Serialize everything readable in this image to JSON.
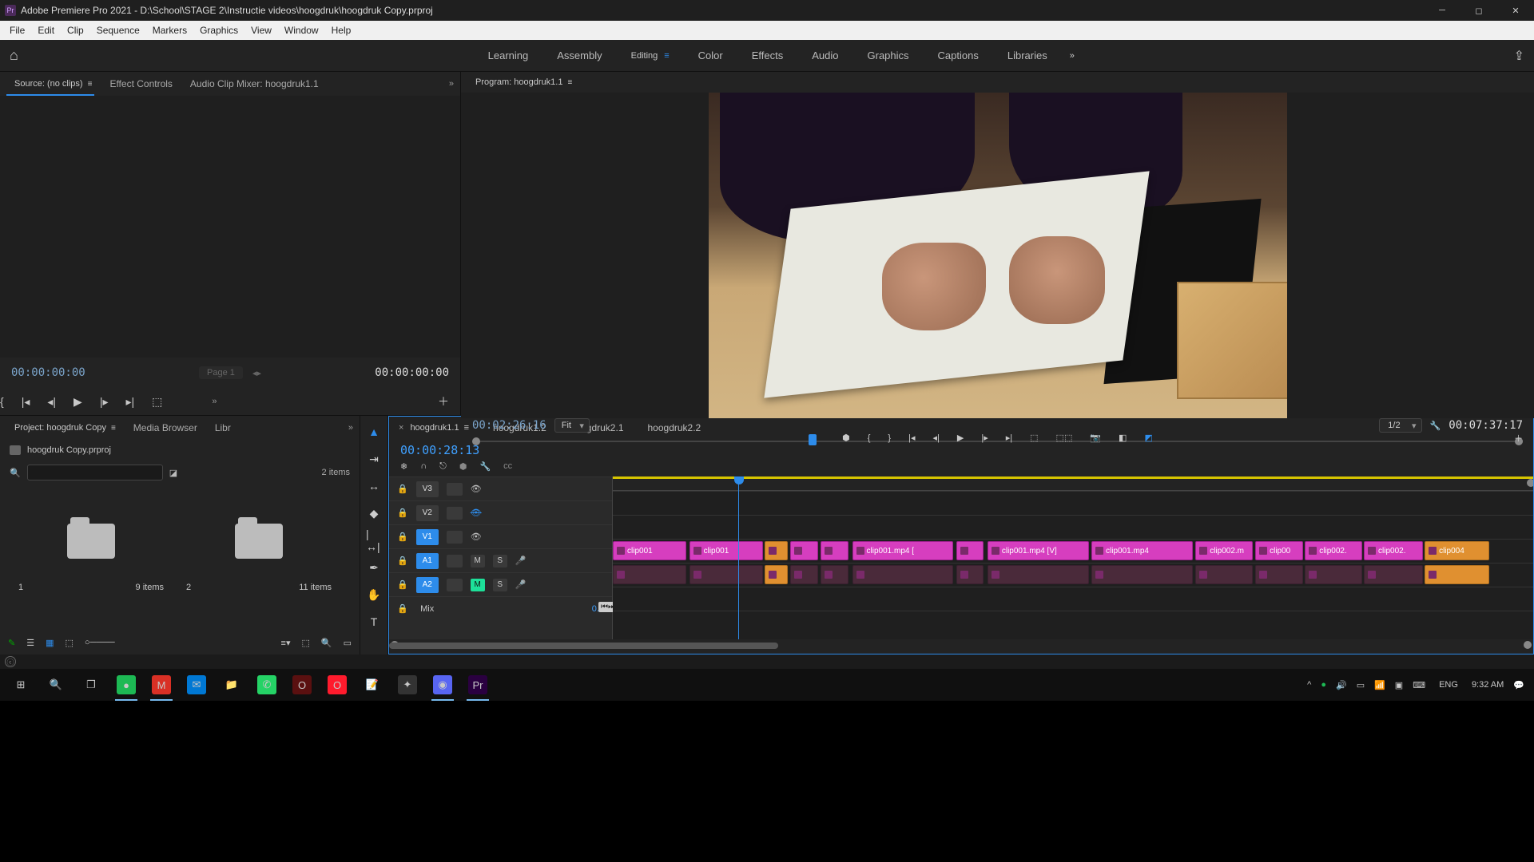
{
  "titlebar": {
    "app_icon_text": "Pr",
    "title": "Adobe Premiere Pro 2021 - D:\\School\\STAGE 2\\Instructie videos\\hoogdruk\\hoogdruk Copy.prproj"
  },
  "menubar": [
    "File",
    "Edit",
    "Clip",
    "Sequence",
    "Markers",
    "Graphics",
    "View",
    "Window",
    "Help"
  ],
  "workspaces": {
    "items": [
      "Learning",
      "Assembly",
      "Editing",
      "Color",
      "Effects",
      "Audio",
      "Graphics",
      "Captions",
      "Libraries"
    ],
    "active_index": 2
  },
  "source_panel": {
    "tabs": [
      "Source: (no clips)",
      "Effect Controls",
      "Audio Clip Mixer: hoogdruk1.1"
    ],
    "active_tab": 0,
    "timecode_left": "00:00:00:00",
    "page": "Page 1",
    "timecode_right": "00:00:00:00"
  },
  "program_panel": {
    "tab": "Program: hoogdruk1.1",
    "timecode_left": "00:02:26:16",
    "fit_label": "Fit",
    "resolution": "1/2",
    "timecode_right": "00:07:37:17",
    "playhead_pct": 32
  },
  "project_panel": {
    "tabs": [
      "Project: hoogdruk Copy",
      "Media Browser",
      "Libr"
    ],
    "active_tab": 0,
    "filename": "hoogdruk Copy.prproj",
    "item_count": "2 items",
    "bins": [
      {
        "id": "1",
        "meta": "9 items"
      },
      {
        "id": "2",
        "meta": "11 items"
      }
    ]
  },
  "timeline": {
    "tabs": [
      "hoogdruk1.1",
      "hoogdruk1.2",
      "hoogdruk2.1",
      "hoogdruk2.2"
    ],
    "active_tab": 0,
    "timecode": "00:00:28:13",
    "tracks": {
      "video": [
        {
          "label": "V3",
          "on": false,
          "visible": true
        },
        {
          "label": "V2",
          "on": false,
          "visible": false
        },
        {
          "label": "V1",
          "on": true,
          "visible": true
        }
      ],
      "audio": [
        {
          "label": "A1",
          "on": true,
          "mute": false
        },
        {
          "label": "A2",
          "on": true,
          "mute": true
        }
      ],
      "mix": {
        "label": "Mix",
        "value": "0.0"
      }
    },
    "v1_clips": [
      {
        "l": 0,
        "w": 8,
        "name": "clip001"
      },
      {
        "l": 8.3,
        "w": 8,
        "name": "clip001"
      },
      {
        "l": 16.5,
        "w": 2.5,
        "name": "",
        "orange": true
      },
      {
        "l": 19.3,
        "w": 3,
        "name": ""
      },
      {
        "l": 22.6,
        "w": 3,
        "name": ""
      },
      {
        "l": 26,
        "w": 11,
        "name": "clip001.mp4 ["
      },
      {
        "l": 37.3,
        "w": 3,
        "name": ""
      },
      {
        "l": 40.7,
        "w": 11,
        "name": "clip001.mp4 [V]"
      },
      {
        "l": 52,
        "w": 11,
        "name": "clip001.mp4"
      },
      {
        "l": 63.3,
        "w": 6.2,
        "name": "clip002.m"
      },
      {
        "l": 69.8,
        "w": 5.2,
        "name": "clip00"
      },
      {
        "l": 75.2,
        "w": 6.2,
        "name": "clip002."
      },
      {
        "l": 81.6,
        "w": 6.4,
        "name": "clip002."
      },
      {
        "l": 88.2,
        "w": 7,
        "name": "clip004",
        "orange": true
      }
    ],
    "a1_clips": [
      {
        "l": 0,
        "w": 8
      },
      {
        "l": 8.3,
        "w": 8
      },
      {
        "l": 16.5,
        "w": 2.5,
        "orange": true
      },
      {
        "l": 19.3,
        "w": 3
      },
      {
        "l": 22.6,
        "w": 3
      },
      {
        "l": 26,
        "w": 11
      },
      {
        "l": 37.3,
        "w": 3
      },
      {
        "l": 40.7,
        "w": 11
      },
      {
        "l": 52,
        "w": 11
      },
      {
        "l": 63.3,
        "w": 6.2
      },
      {
        "l": 69.8,
        "w": 5.2
      },
      {
        "l": 75.2,
        "w": 6.2
      },
      {
        "l": 81.6,
        "w": 6.4
      },
      {
        "l": 88.2,
        "w": 7,
        "orange": true
      }
    ],
    "playhead_pct": 13.6,
    "yellow_work_area_pct": 100,
    "scroll_thumb": {
      "left_pct": 0,
      "width_pct": 34
    }
  },
  "taskbar": {
    "apps": [
      {
        "name": "start",
        "glyph": "⊞",
        "bg": ""
      },
      {
        "name": "search",
        "glyph": "🔍",
        "bg": ""
      },
      {
        "name": "task-view",
        "glyph": "❐",
        "bg": ""
      },
      {
        "name": "spotify",
        "glyph": "●",
        "bg": "#1db954",
        "running": true
      },
      {
        "name": "mail-m",
        "glyph": "M",
        "bg": "#d93025",
        "running": true
      },
      {
        "name": "mail",
        "glyph": "✉",
        "bg": "#0078d4"
      },
      {
        "name": "explorer",
        "glyph": "📁",
        "bg": ""
      },
      {
        "name": "whatsapp",
        "glyph": "✆",
        "bg": "#25d366"
      },
      {
        "name": "opera1",
        "glyph": "O",
        "bg": "#5a1010"
      },
      {
        "name": "opera2",
        "glyph": "O",
        "bg": "#ff1b2d"
      },
      {
        "name": "notes",
        "glyph": "📝",
        "bg": ""
      },
      {
        "name": "app-x",
        "glyph": "✦",
        "bg": "#333"
      },
      {
        "name": "discord",
        "glyph": "◉",
        "bg": "#5865f2",
        "running": true
      },
      {
        "name": "premiere",
        "glyph": "Pr",
        "bg": "#2a0040",
        "running": true
      }
    ],
    "tray": {
      "lang": "ENG",
      "time": "9:32 AM"
    }
  }
}
